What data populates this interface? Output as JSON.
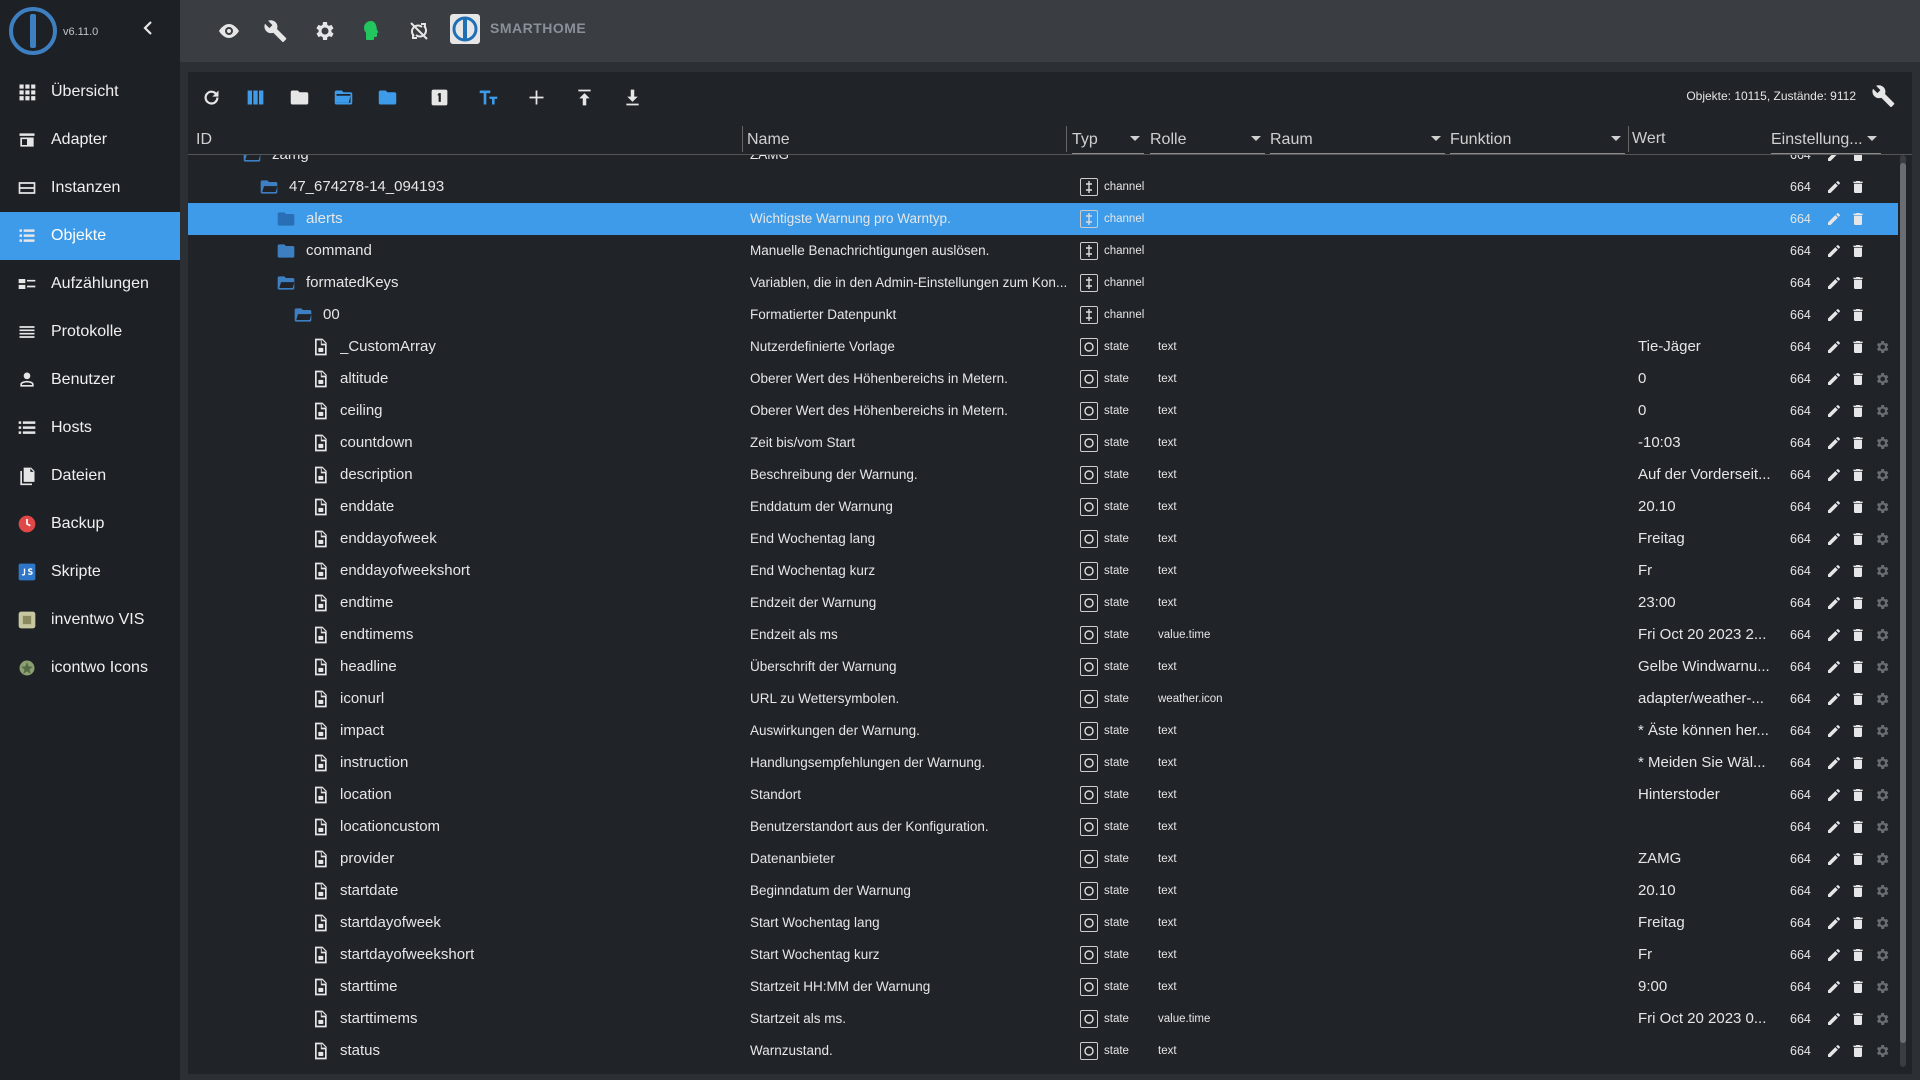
{
  "app": {
    "version": "v6.11.0",
    "brand": "SMARTHOME"
  },
  "colors": {
    "accent": "#3d9be9",
    "sidebar_bg": "#1d2125",
    "panel_bg": "#202327",
    "green_icon": "#22c55e"
  },
  "sidebar": {
    "items": [
      {
        "label": "Übersicht",
        "icon": "grid-icon"
      },
      {
        "label": "Adapter",
        "icon": "store-icon"
      },
      {
        "label": "Instanzen",
        "icon": "instances-icon"
      },
      {
        "label": "Objekte",
        "icon": "list-icon",
        "active": true
      },
      {
        "label": "Aufzählungen",
        "icon": "enum-icon"
      },
      {
        "label": "Protokolle",
        "icon": "log-icon"
      },
      {
        "label": "Benutzer",
        "icon": "user-icon"
      },
      {
        "label": "Hosts",
        "icon": "hosts-icon"
      },
      {
        "label": "Dateien",
        "icon": "files-icon"
      },
      {
        "label": "Backup",
        "icon": "backup-icon"
      },
      {
        "label": "Skripte",
        "icon": "scripts-icon"
      },
      {
        "label": "inventwo VIS",
        "icon": "vis-icon"
      },
      {
        "label": "icontwo Icons",
        "icon": "icons-icon"
      }
    ]
  },
  "toolbar": {
    "counts": "Objekte: 10115, Zustände: 9112"
  },
  "columns": {
    "id": "ID",
    "name": "Name",
    "type": "Typ",
    "role": "Rolle",
    "room": "Raum",
    "function": "Funktion",
    "value": "Wert",
    "settings": "Einstellung..."
  },
  "rows": [
    {
      "id": "zamg",
      "name": "ZAMG",
      "kind": "folder-open",
      "level": 0,
      "type": "",
      "role": "",
      "value": "",
      "acl": "664",
      "partial": true
    },
    {
      "id": "47_674278-14_094193",
      "name": "",
      "kind": "folder-open",
      "level": 1,
      "type": "channel",
      "role": "",
      "value": "",
      "acl": "664"
    },
    {
      "id": "alerts",
      "name": "Wichtigste Warnung pro Warntyp.",
      "kind": "folder",
      "level": 2,
      "type": "channel",
      "role": "",
      "value": "",
      "acl": "664",
      "selected": true
    },
    {
      "id": "command",
      "name": "Manuelle Benachrichtigungen auslösen.",
      "kind": "folder",
      "level": 2,
      "type": "channel",
      "role": "",
      "value": "",
      "acl": "664"
    },
    {
      "id": "formatedKeys",
      "name": "Variablen, die in den Admin-Einstellungen zum Kon...",
      "kind": "folder-open",
      "level": 2,
      "type": "channel",
      "role": "",
      "value": "",
      "acl": "664"
    },
    {
      "id": "00",
      "name": "Formatierter Datenpunkt",
      "kind": "folder-open",
      "level": 3,
      "type": "channel",
      "role": "",
      "value": "",
      "acl": "664"
    },
    {
      "id": "_CustomArray",
      "name": "Nutzerdefinierte Vorlage",
      "kind": "file",
      "level": 4,
      "type": "state",
      "role": "text",
      "value": "Tie-Jäger",
      "acl": "664"
    },
    {
      "id": "altitude",
      "name": "Oberer Wert des Höhenbereichs in Metern.",
      "kind": "file",
      "level": 4,
      "type": "state",
      "role": "text",
      "value": "0",
      "acl": "664"
    },
    {
      "id": "ceiling",
      "name": "Oberer Wert des Höhenbereichs in Metern.",
      "kind": "file",
      "level": 4,
      "type": "state",
      "role": "text",
      "value": "0",
      "acl": "664"
    },
    {
      "id": "countdown",
      "name": "Zeit bis/vom Start",
      "kind": "file",
      "level": 4,
      "type": "state",
      "role": "text",
      "value": "-10:03",
      "acl": "664"
    },
    {
      "id": "description",
      "name": "Beschreibung der Warnung.",
      "kind": "file",
      "level": 4,
      "type": "state",
      "role": "text",
      "value": "Auf der Vorderseit...",
      "acl": "664"
    },
    {
      "id": "enddate",
      "name": "Enddatum der Warnung",
      "kind": "file",
      "level": 4,
      "type": "state",
      "role": "text",
      "value": "20.10",
      "acl": "664"
    },
    {
      "id": "enddayofweek",
      "name": "End Wochentag lang",
      "kind": "file",
      "level": 4,
      "type": "state",
      "role": "text",
      "value": "Freitag",
      "acl": "664"
    },
    {
      "id": "enddayofweekshort",
      "name": "End Wochentag kurz",
      "kind": "file",
      "level": 4,
      "type": "state",
      "role": "text",
      "value": "Fr",
      "acl": "664"
    },
    {
      "id": "endtime",
      "name": "Endzeit der Warnung",
      "kind": "file",
      "level": 4,
      "type": "state",
      "role": "text",
      "value": "23:00",
      "acl": "664"
    },
    {
      "id": "endtimems",
      "name": "Endzeit als ms",
      "kind": "file",
      "level": 4,
      "type": "state",
      "role": "value.time",
      "value": "Fri Oct 20 2023 2...",
      "acl": "664"
    },
    {
      "id": "headline",
      "name": "Überschrift der Warnung",
      "kind": "file",
      "level": 4,
      "type": "state",
      "role": "text",
      "value": "Gelbe Windwarnu...",
      "acl": "664"
    },
    {
      "id": "iconurl",
      "name": "URL zu Wettersymbolen.",
      "kind": "file",
      "level": 4,
      "type": "state",
      "role": "weather.icon",
      "value": "adapter/weather-...",
      "acl": "664"
    },
    {
      "id": "impact",
      "name": "Auswirkungen der Warnung.",
      "kind": "file",
      "level": 4,
      "type": "state",
      "role": "text",
      "value": "* Äste können her...",
      "acl": "664"
    },
    {
      "id": "instruction",
      "name": "Handlungsempfehlungen der Warnung.",
      "kind": "file",
      "level": 4,
      "type": "state",
      "role": "text",
      "value": "* Meiden Sie Wäl...",
      "acl": "664"
    },
    {
      "id": "location",
      "name": "Standort",
      "kind": "file",
      "level": 4,
      "type": "state",
      "role": "text",
      "value": "Hinterstoder",
      "acl": "664"
    },
    {
      "id": "locationcustom",
      "name": "Benutzerstandort aus der Konfiguration.",
      "kind": "file",
      "level": 4,
      "type": "state",
      "role": "text",
      "value": "",
      "acl": "664"
    },
    {
      "id": "provider",
      "name": "Datenanbieter",
      "kind": "file",
      "level": 4,
      "type": "state",
      "role": "text",
      "value": "ZAMG",
      "acl": "664"
    },
    {
      "id": "startdate",
      "name": "Beginndatum der Warnung",
      "kind": "file",
      "level": 4,
      "type": "state",
      "role": "text",
      "value": "20.10",
      "acl": "664"
    },
    {
      "id": "startdayofweek",
      "name": "Start Wochentag lang",
      "kind": "file",
      "level": 4,
      "type": "state",
      "role": "text",
      "value": "Freitag",
      "acl": "664"
    },
    {
      "id": "startdayofweekshort",
      "name": "Start Wochentag kurz",
      "kind": "file",
      "level": 4,
      "type": "state",
      "role": "text",
      "value": "Fr",
      "acl": "664"
    },
    {
      "id": "starttime",
      "name": "Startzeit HH:MM der Warnung",
      "kind": "file",
      "level": 4,
      "type": "state",
      "role": "text",
      "value": "9:00",
      "acl": "664"
    },
    {
      "id": "starttimems",
      "name": "Startzeit als ms.",
      "kind": "file",
      "level": 4,
      "type": "state",
      "role": "value.time",
      "value": "Fri Oct 20 2023 0...",
      "acl": "664"
    },
    {
      "id": "status",
      "name": "Warnzustand.",
      "kind": "file",
      "level": 4,
      "type": "state",
      "role": "text",
      "value": "",
      "acl": "664"
    }
  ]
}
